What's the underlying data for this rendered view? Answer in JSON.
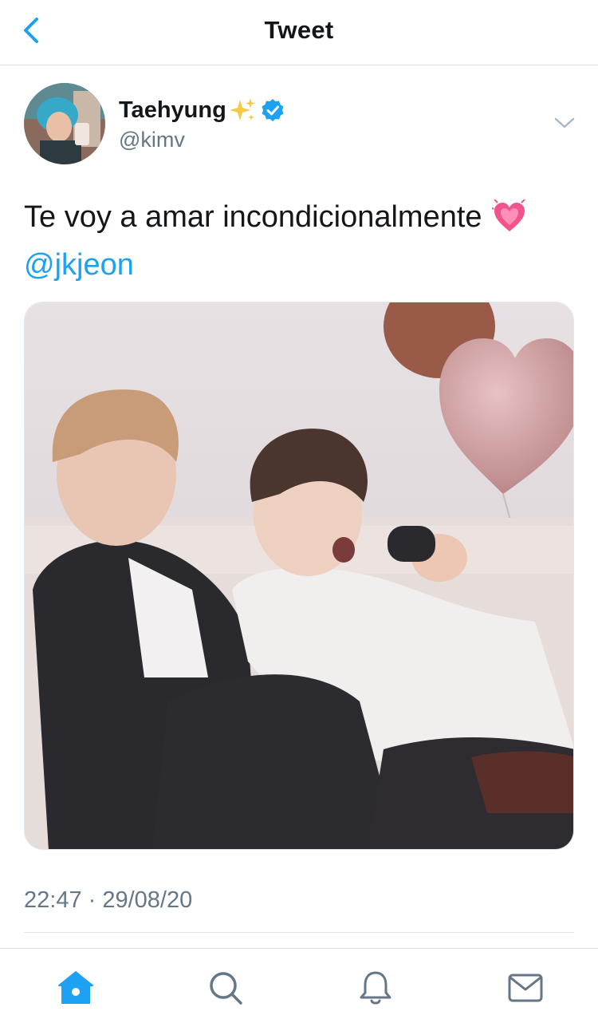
{
  "header": {
    "title": "Tweet",
    "back_icon": "chevron-left-icon",
    "accent": "#1da1f2"
  },
  "tweet": {
    "display_name": "Taehyung",
    "name_emoji": "sparkles-icon",
    "verified_icon": "verified-badge-icon",
    "handle": "@kimv",
    "text_line1": "Te voy a amar incondicionalmente",
    "text_emoji": "growing-heart-icon",
    "mention": "@jkjeon",
    "time": "22:47 · 29/08/20",
    "menu_icon": "chevron-down-icon"
  },
  "tabbar": {
    "items": [
      {
        "icon": "home-icon",
        "active": true
      },
      {
        "icon": "search-icon",
        "active": false
      },
      {
        "icon": "notifications-bell-icon",
        "active": false
      },
      {
        "icon": "messages-envelope-icon",
        "active": false
      }
    ]
  },
  "colors": {
    "text_primary": "#14171a",
    "text_secondary": "#657786",
    "link": "#1da1f2",
    "divider": "#e1e8ed"
  }
}
